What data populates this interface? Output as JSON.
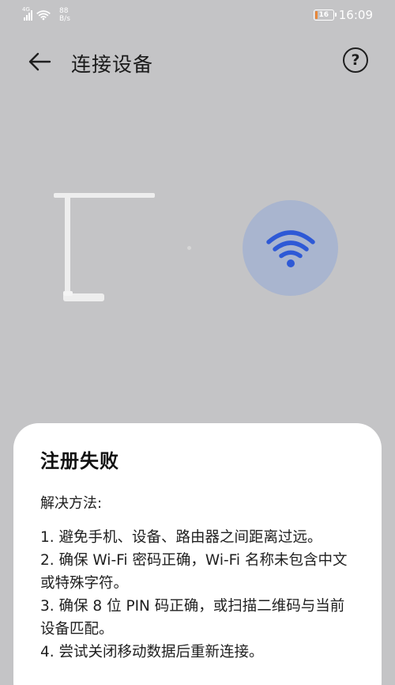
{
  "status_bar": {
    "network_type": "4G",
    "speed_value": "88",
    "speed_unit": "B/s",
    "battery_level": "16",
    "time": "16:09"
  },
  "nav": {
    "title": "连接设备",
    "help_label": "?"
  },
  "device_illustration": {
    "lamp_icon": "desk-lamp-icon",
    "wifi_icon": "wifi-icon",
    "wifi_color": "#2e59d6",
    "circle_color": "#a9b5cf"
  },
  "sheet": {
    "title": "注册失败",
    "subtitle": "解决方法:",
    "steps": [
      "1. 避免手机、设备、路由器之间距离过远。",
      "2. 确保 Wi-Fi 密码正确，Wi-Fi 名称未包含中文或特殊字符。",
      "3. 确保 8 位 PIN 码正确，或扫描二维码与当前设备匹配。",
      "4. 尝试关闭移动数据后重新连接。"
    ]
  }
}
